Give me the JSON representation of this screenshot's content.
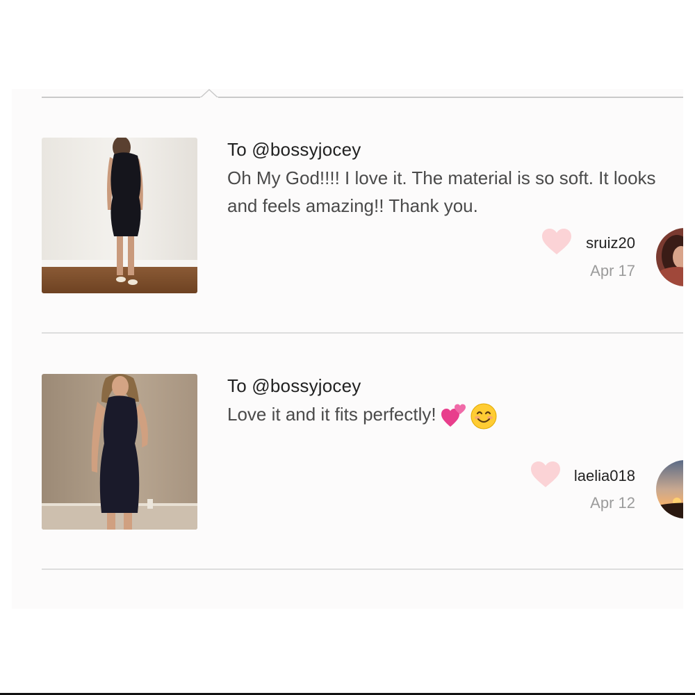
{
  "reviews": [
    {
      "to": "To @bossyjocey",
      "text": "Oh My God!!!! I love it. The material is so soft. It looks and feels amazing!! Thank you.",
      "username": "sruiz20",
      "date": "Apr 17",
      "liked": true,
      "heart_color": "#fbd3d6",
      "emoji": []
    },
    {
      "to": "To @bossyjocey",
      "text": "Love it and it fits perfectly!",
      "username": "laelia018",
      "date": "Apr 12",
      "liked": true,
      "heart_color": "#fbd3d6",
      "emoji": [
        "two-hearts-icon",
        "smiling-face-icon"
      ]
    }
  ],
  "colors": {
    "panel_bg": "#fcfbfb",
    "divider": "#dddddd",
    "text_primary": "#222222",
    "text_body": "#4a4a4a",
    "text_muted": "#9b9b9b"
  }
}
